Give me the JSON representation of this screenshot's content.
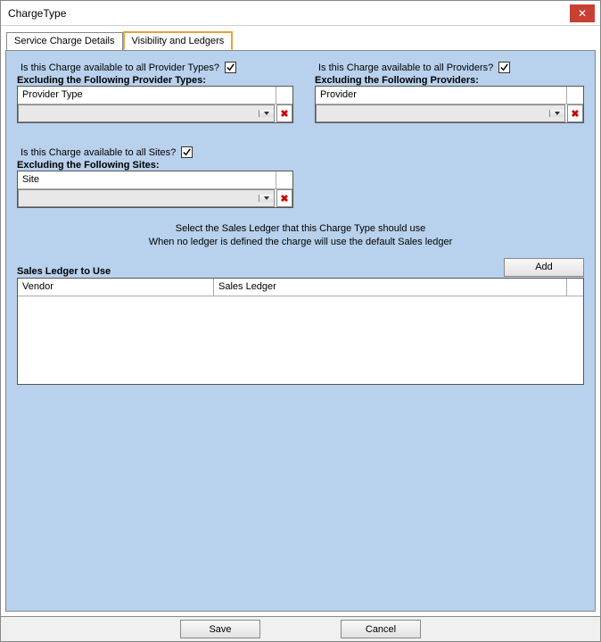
{
  "window": {
    "title": "ChargeType"
  },
  "tabs": {
    "service": "Service Charge Details",
    "visibility": "Visibility and Ledgers",
    "active": "visibility"
  },
  "providerTypes": {
    "question": "Is this Charge available to all Provider Types?",
    "checked": true,
    "exclude_label": "Excluding the Following Provider Types:",
    "column": "Provider Type"
  },
  "sites": {
    "question": "Is this Charge available to all Sites?",
    "checked": true,
    "exclude_label": "Excluding the Following Sites:",
    "column": "Site"
  },
  "providers": {
    "question": "Is this Charge available to all Providers?",
    "checked": true,
    "exclude_label": "Excluding the Following Providers:",
    "column": "Provider"
  },
  "ledger": {
    "help_line1": "Select the Sales Ledger that this Charge Type should use",
    "help_line2": "When no ledger is defined the charge will use the default Sales ledger",
    "title": "Sales Ledger to Use",
    "add_label": "Add",
    "col_vendor": "Vendor",
    "col_sales": "Sales Ledger"
  },
  "footer": {
    "save": "Save",
    "cancel": "Cancel"
  }
}
